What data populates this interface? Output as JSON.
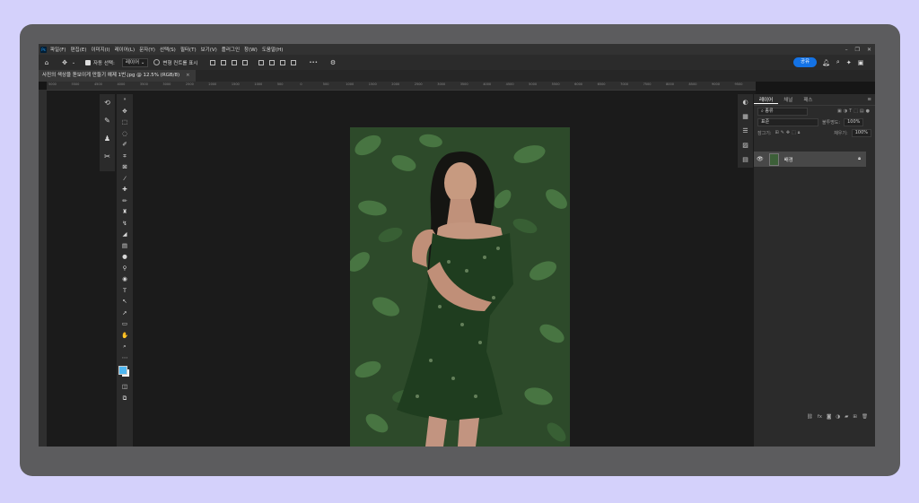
{
  "menubar": {
    "app_logo": "Ps",
    "items": [
      "파일(F)",
      "편집(E)",
      "이미지(I)",
      "레이어(L)",
      "문자(Y)",
      "선택(S)",
      "필터(T)",
      "보기(V)",
      "플러그인",
      "창(W)",
      "도움말(H)"
    ]
  },
  "options": {
    "auto_select_label": "자동 선택:",
    "auto_select_value": "레이어",
    "transform_controls_label": "변형 컨트롤 표시",
    "more_label": "•••",
    "share_label": "공유"
  },
  "document": {
    "tab_title": "사진의 색상을 돋보이게 만들기 예제 1번.jpg @ 12.5% (RGB/8)"
  },
  "ruler": {
    "h_ticks": [
      "5000",
      "5500",
      "4500",
      "4000",
      "3500",
      "3000",
      "2500",
      "2000",
      "1500",
      "1000",
      "500",
      "0",
      "500",
      "1000",
      "1500",
      "2000",
      "2500",
      "3000",
      "3500",
      "4000",
      "4500",
      "5000",
      "5500",
      "6000",
      "6500",
      "7000",
      "7500",
      "8000",
      "8500",
      "9000",
      "9500"
    ]
  },
  "layers_panel": {
    "tabs": [
      "레이어",
      "채널",
      "패스"
    ],
    "kind_filter": "종류",
    "blend_mode": "표준",
    "opacity_label": "불투명도:",
    "opacity_value": "100%",
    "lock_label": "잠그기:",
    "fill_label": "채우기:",
    "fill_value": "100%",
    "layers": [
      {
        "name": "배경"
      }
    ]
  }
}
